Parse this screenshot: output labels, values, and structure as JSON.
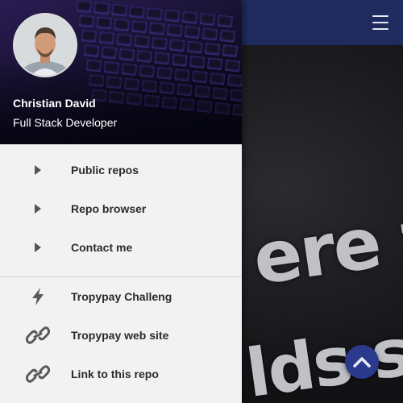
{
  "profile": {
    "name": "Christian David",
    "role": "Full Stack Developer",
    "avatar_icon": "profile-photo"
  },
  "nav_primary": [
    {
      "label": "Public repos",
      "icon": "caret-right-icon"
    },
    {
      "label": "Repo browser",
      "icon": "caret-right-icon"
    },
    {
      "label": "Contact me",
      "icon": "caret-right-icon"
    }
  ],
  "nav_secondary": [
    {
      "label": "Tropypay Challeng",
      "icon": "lightning-icon"
    },
    {
      "label": "Tropypay web site",
      "icon": "link-icon"
    },
    {
      "label": "Link to this repo",
      "icon": "link-icon"
    }
  ],
  "background": {
    "hero_line1": "ere th",
    "hero_line2": "lds sc"
  },
  "colors": {
    "app_bar": "#1f2a5e",
    "drawer": "#f2f2f2",
    "fab": "#2b3a8c"
  }
}
